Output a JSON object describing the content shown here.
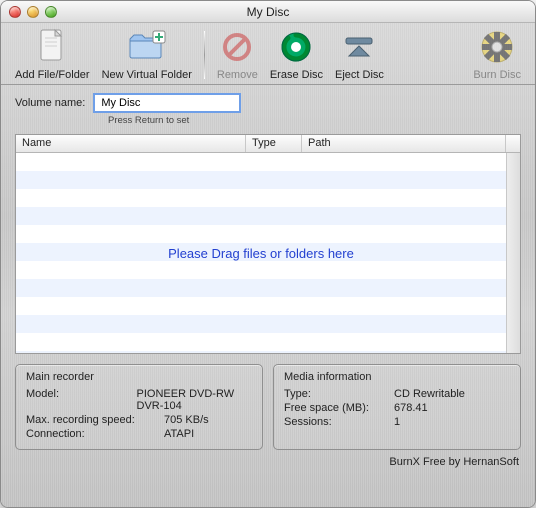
{
  "window": {
    "title": "My Disc"
  },
  "toolbar": {
    "add": {
      "label": "Add File/Folder"
    },
    "newfolder": {
      "label": "New Virtual Folder"
    },
    "remove": {
      "label": "Remove"
    },
    "erase": {
      "label": "Erase Disc"
    },
    "eject": {
      "label": "Eject Disc"
    },
    "burn": {
      "label": "Burn Disc"
    }
  },
  "volume": {
    "label": "Volume name:",
    "value": "My Disc",
    "hint": "Press Return to set"
  },
  "table": {
    "columns": {
      "name": "Name",
      "type": "Type",
      "path": "Path"
    },
    "empty_message": "Please Drag files or folders here",
    "rows": []
  },
  "recorder": {
    "title": "Main recorder",
    "model_label": "Model:",
    "model": "PIONEER DVD-RW DVR-104",
    "speed_label": "Max. recording speed:",
    "speed": "705 KB/s",
    "connection_label": "Connection:",
    "connection": "ATAPI"
  },
  "media": {
    "title": "Media information",
    "type_label": "Type:",
    "type": "CD Rewritable",
    "free_label": "Free space (MB):",
    "free": "678.41",
    "sessions_label": "Sessions:",
    "sessions": "1"
  },
  "credit": "BurnX Free by HernanSoft"
}
